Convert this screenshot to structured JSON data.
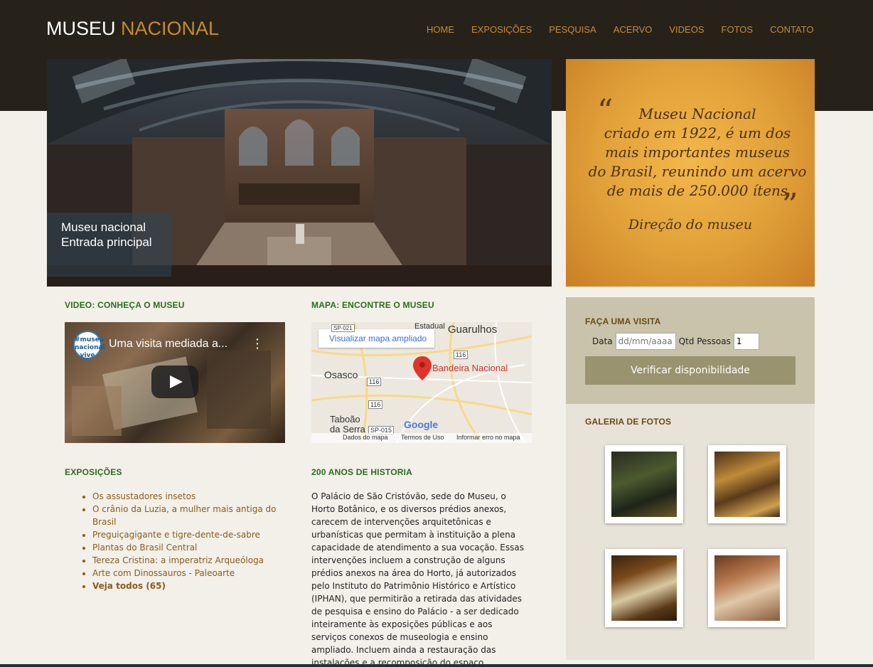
{
  "header": {
    "logo_part1": "MUSEU",
    "logo_part2": "NACIONAL",
    "nav": [
      "HOME",
      "EXPOSIÇÕES",
      "PESQUISA",
      "ACERVO",
      "VIDEOS",
      "FOTOS",
      "CONTATO"
    ]
  },
  "hero": {
    "caption_line1": "Museu nacional",
    "caption_line2": "Entrada principal"
  },
  "quote": {
    "lines": [
      "Museu Nacional",
      "criado em 1922, é um dos",
      "mais importantes museus",
      "do Brasil, reunindo um acervo",
      "de mais de 250.000 ítens"
    ],
    "author": "Direção do museu"
  },
  "video_section": {
    "title": "VIDEO: CONHEÇA O MUSEU",
    "video_title": "Uma visita mediada a...",
    "channel_logo_lines": [
      "#museu",
      "nacional",
      "vive"
    ]
  },
  "map_section": {
    "title": "MAPA: ENCONTRE O MUSEU",
    "enlarge_link": "Visualizar mapa ampliado",
    "pin_label": "Bandeira Nacional",
    "places": [
      "Guarulhos",
      "Osasco",
      "Taboão da Serra",
      "Estadual"
    ],
    "road_labels": [
      "116",
      "116",
      "116",
      "SP-015",
      "SP-021"
    ],
    "provider": "Google",
    "footer": [
      "Dados do mapa",
      "Termos de Uso",
      "Informar erro no mapa"
    ]
  },
  "exposicoes": {
    "title": "EXPOSIÇÕES",
    "items": [
      "Os assustadores insetos",
      "O crânio da Luzia, a mulher mais antiga do Brasil",
      "Preguiçagigante e tigre-dente-de-sabre",
      "Plantas do Brasil Central",
      "Tereza Cristina: a imperatriz Arqueóloga",
      "Arte com Dinossauros - Paleoarte"
    ],
    "see_all": "Veja todos (65)"
  },
  "historia": {
    "title": "200 ANOS DE HISTORIA",
    "text": "O Palácio de São Cristóvão, sede do Museu, o Horto Botânico, e os diversos prédios anexos, carecem de intervenções arquitetônicas e urbanísticas que permitam à instituição a plena capacidade de atendimento a sua vocação. Essas intervenções incluem a construção de alguns prédios anexos na área do Horto, já autorizados pelo Instituto do Patrimônio Histórico e Artístico (IPHAN), que permitirão a retirada das atividades de pesquisa e ensino do Palácio - a ser dedicado inteiramente às exposições públicas e aos serviços conexos de museologia e ensino ampliado. Incluem ainda a restauração das instalações e a recomposição do espaço expositivo do Palácio em seus três andares."
  },
  "visita": {
    "title": "FAÇA UMA VISITA",
    "date_label": "Data",
    "date_placeholder": "dd/mm/aaaa",
    "qty_label": "Qtd Pessoas",
    "qty_value": "1",
    "button": "Verificar disponibilidade"
  },
  "galeria": {
    "title": "GALERIA DE FOTOS"
  }
}
